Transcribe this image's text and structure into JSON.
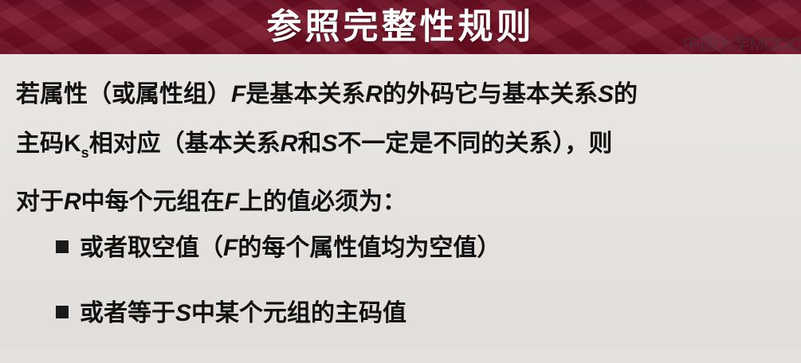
{
  "header": {
    "title": "参照完整性规则",
    "watermark": "中国大学MOOC"
  },
  "paragraph": {
    "line1": [
      {
        "t": "若属性（或属性组）",
        "i": false
      },
      {
        "t": "F",
        "i": true
      },
      {
        "t": "是基本关系",
        "i": false
      },
      {
        "t": "R",
        "i": true
      },
      {
        "t": "的外码它与基本关系",
        "i": false
      },
      {
        "t": "S",
        "i": true
      },
      {
        "t": "的",
        "i": false
      }
    ],
    "line2": [
      {
        "t": "主码",
        "i": false
      },
      {
        "t": "K",
        "i": false,
        "b": true
      },
      {
        "t": "s",
        "sub": true
      },
      {
        "t": "相对应（基本关系",
        "i": false
      },
      {
        "t": "R",
        "i": true
      },
      {
        "t": "和",
        "i": false
      },
      {
        "t": "S",
        "i": true
      },
      {
        "t": "不一定是不同的关系），则",
        "i": false
      }
    ],
    "line3": [
      {
        "t": "对于",
        "i": false
      },
      {
        "t": "R",
        "i": true
      },
      {
        "t": "中每个元组在",
        "i": false
      },
      {
        "t": "F",
        "i": true
      },
      {
        "t": "上的值必须为：",
        "i": false
      }
    ]
  },
  "bullets": [
    [
      {
        "t": "或者取空值（",
        "i": false
      },
      {
        "t": "F",
        "i": true
      },
      {
        "t": "的每个属性值均为空值）",
        "i": false
      }
    ],
    [
      {
        "t": "或者等于",
        "i": false
      },
      {
        "t": "S",
        "i": true
      },
      {
        "t": "中某个元组的主码值",
        "i": false
      }
    ]
  ]
}
